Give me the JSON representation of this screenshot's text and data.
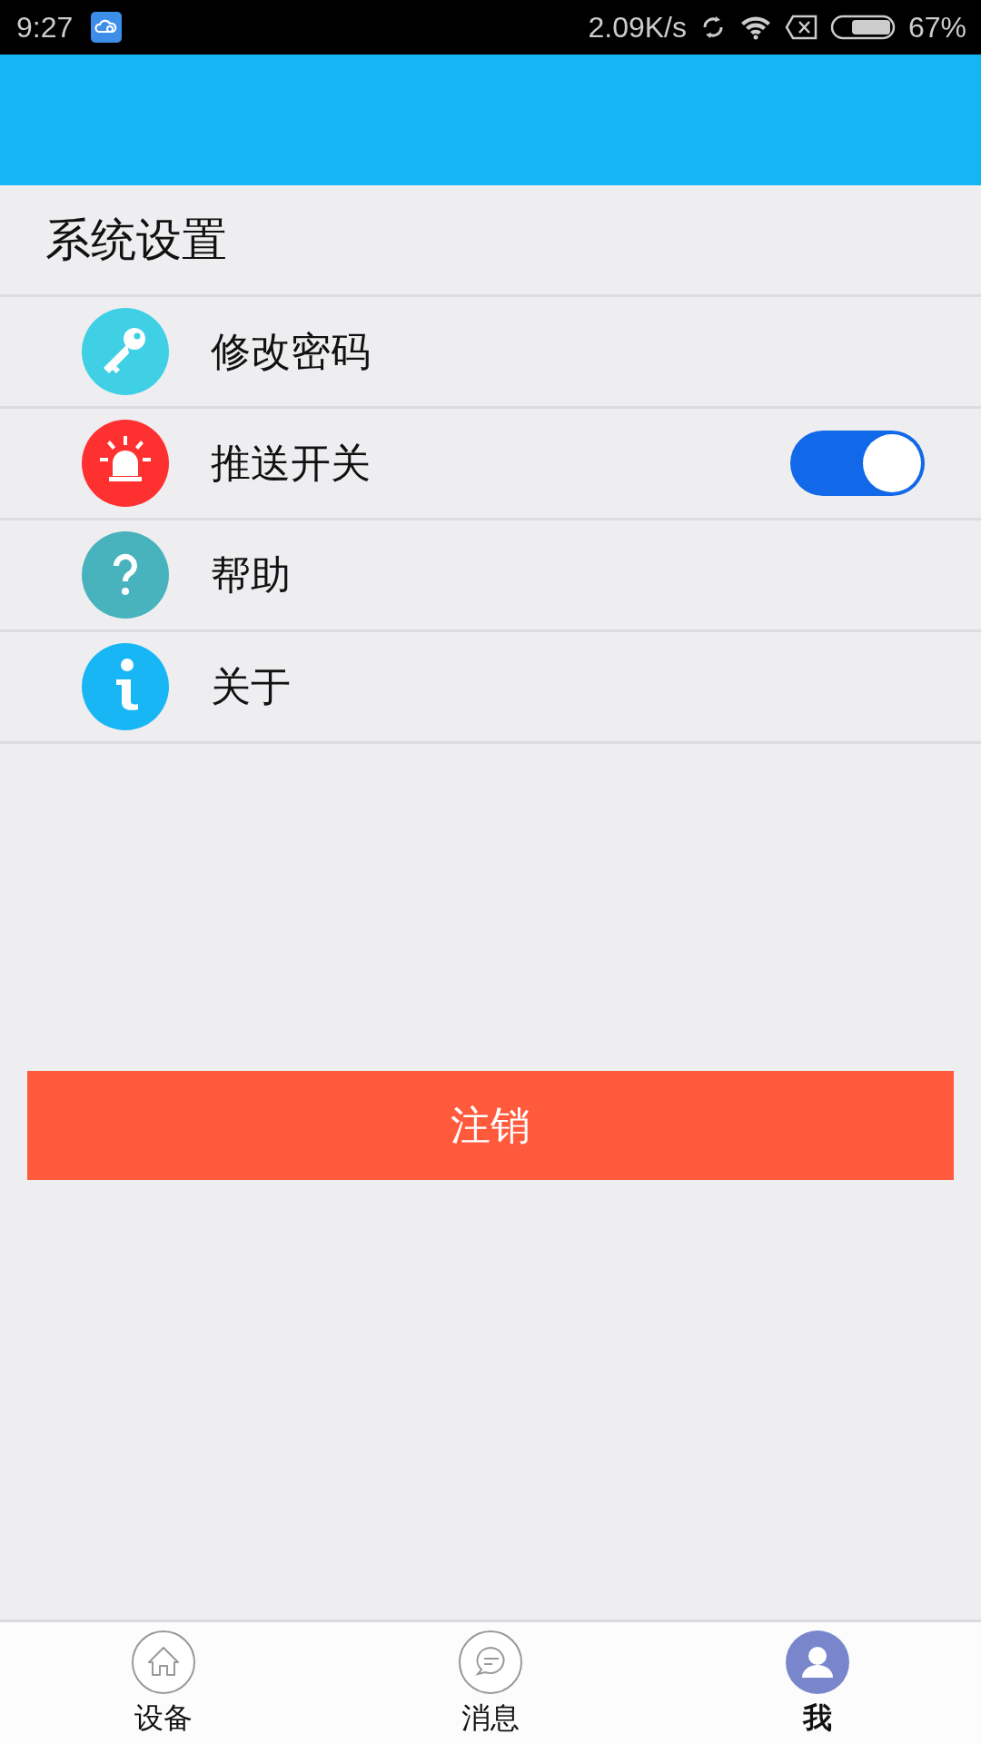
{
  "status_bar": {
    "time": "9:27",
    "speed": "2.09K/s",
    "battery": "67%"
  },
  "section_title": "系统设置",
  "settings": [
    {
      "kind": "link",
      "label": "修改密码"
    },
    {
      "kind": "toggle",
      "label": "推送开关",
      "on": true
    },
    {
      "kind": "link",
      "label": "帮助"
    },
    {
      "kind": "link",
      "label": "关于"
    }
  ],
  "logout_button": "注销",
  "bottom_nav": [
    {
      "label": "设备",
      "selected": false
    },
    {
      "label": "消息",
      "selected": false
    },
    {
      "label": "我",
      "selected": true
    }
  ]
}
